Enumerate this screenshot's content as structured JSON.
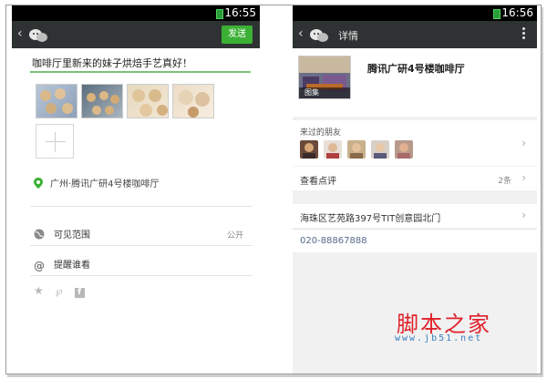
{
  "left": {
    "status_time": "16:55",
    "send_label": "发送",
    "post_text": "咖啡厅里新来的妹子烘焙手艺真好！",
    "location": "广州·腾讯广研4号楼咖啡厅",
    "visibility_label": "可见范围",
    "visibility_value": "公开",
    "remind_label": "提醒谁看"
  },
  "right": {
    "status_time": "16:56",
    "title": "详情",
    "place_name": "腾讯广研4号楼咖啡厅",
    "album_tag": "图集",
    "friends_label": "来过的朋友",
    "reviews_label": "查看点评",
    "reviews_count": "2条",
    "address": "海珠区艺苑路397号TIT创意园北门",
    "phone": "020-88867888"
  },
  "watermark": {
    "logo": "脚本之家",
    "url": "www.jb51.net"
  },
  "colors": {
    "topbar": "#2f3233",
    "send": "#3cb035",
    "location_icon": "#3cb035",
    "watermark_logo": "#e0202a",
    "watermark_url": "#3a7fc0"
  }
}
